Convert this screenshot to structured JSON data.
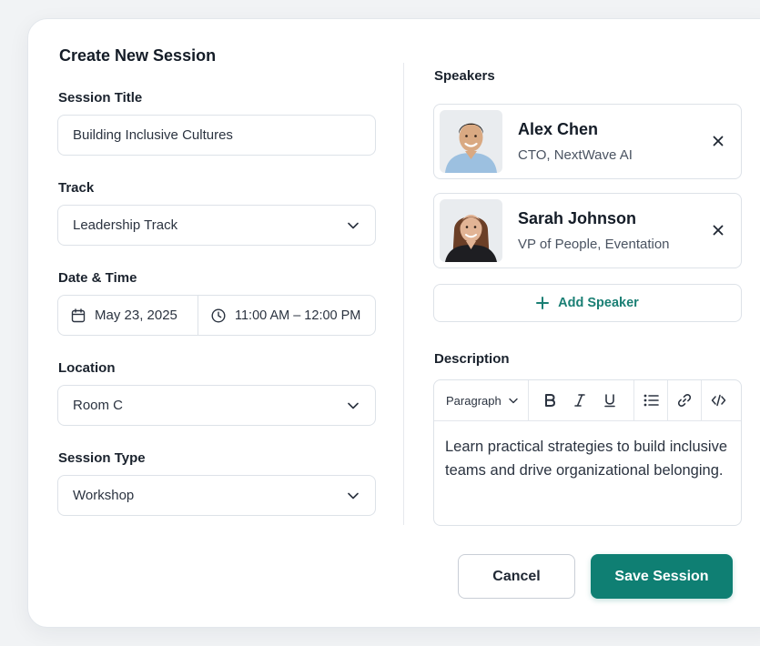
{
  "form": {
    "title": "Create New Session",
    "session_title": {
      "label": "Session Title",
      "value": "Building Inclusive Cultures"
    },
    "track": {
      "label": "Track",
      "value": "Leadership Track"
    },
    "date_time": {
      "label": "Date & Time",
      "date": "May 23, 2025",
      "time": "11:00 AM – 12:00 PM"
    },
    "location": {
      "label": "Location",
      "value": "Room C"
    },
    "session_type": {
      "label": "Session Type",
      "value": "Workshop"
    }
  },
  "speakers": {
    "label": "Speakers",
    "items": [
      {
        "name": "Alex Chen",
        "role": "CTO, NextWave AI",
        "avatar_icon": "avatar-photo-man"
      },
      {
        "name": "Sarah Johnson",
        "role": "VP of People, Eventation",
        "avatar_icon": "avatar-photo-woman"
      }
    ],
    "add_label": "Add Speaker"
  },
  "description": {
    "label": "Description",
    "format": "Paragraph",
    "text": "Learn practical strategies to build inclusive teams and drive organizational belonging."
  },
  "actions": {
    "cancel": "Cancel",
    "save": "Save Session"
  },
  "colors": {
    "accent": "#0f7f73",
    "border": "#dde2e8"
  }
}
